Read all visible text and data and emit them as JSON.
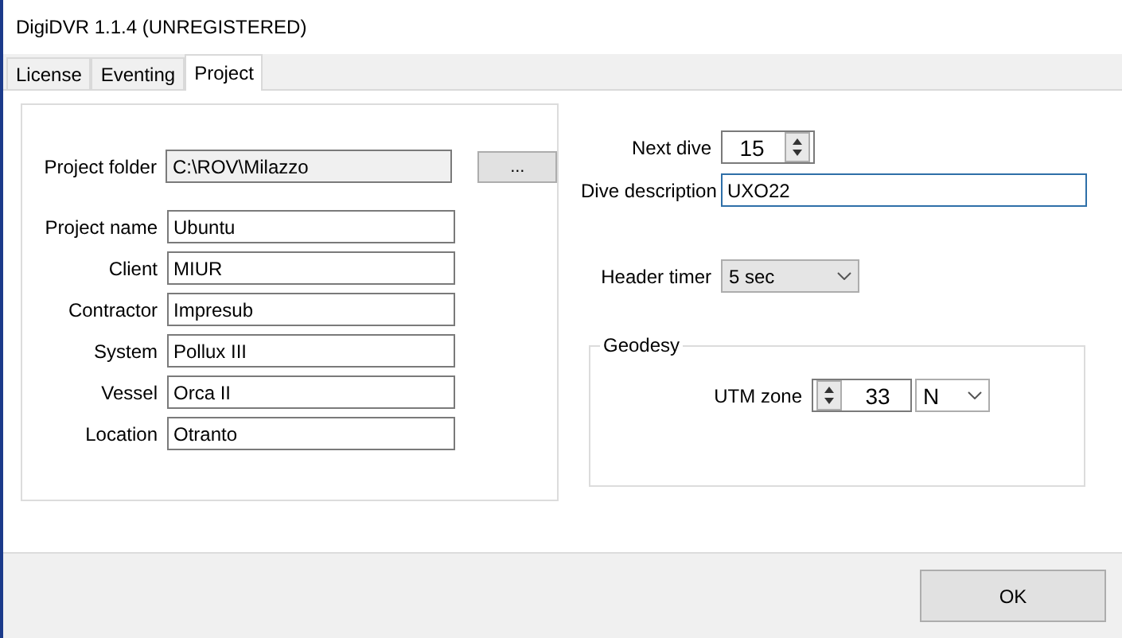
{
  "window": {
    "title": "DigiDVR 1.1.4 (UNREGISTERED)"
  },
  "tabs": [
    {
      "label": "License",
      "selected": false
    },
    {
      "label": "Eventing",
      "selected": false
    },
    {
      "label": "Project",
      "selected": true
    }
  ],
  "project_folder": {
    "label": "Project folder",
    "value": "C:\\ROV\\Milazzo",
    "browse": "..."
  },
  "fields": [
    {
      "label": "Project name",
      "value": "Ubuntu"
    },
    {
      "label": "Client",
      "value": "MIUR"
    },
    {
      "label": "Contractor",
      "value": "Impresub"
    },
    {
      "label": "System",
      "value": "Pollux III"
    },
    {
      "label": "Vessel",
      "value": "Orca II"
    },
    {
      "label": "Location",
      "value": "Otranto"
    }
  ],
  "next_dive": {
    "label": "Next dive",
    "value": "15"
  },
  "dive_description": {
    "label": "Dive description",
    "value": "UXO22",
    "focused": true
  },
  "header_timer": {
    "label": "Header timer",
    "value": "5 sec"
  },
  "geodesy": {
    "title": "Geodesy",
    "utm_zone": {
      "label": "UTM zone",
      "value": "33",
      "hemisphere": "N"
    }
  },
  "ok_button": "OK"
}
